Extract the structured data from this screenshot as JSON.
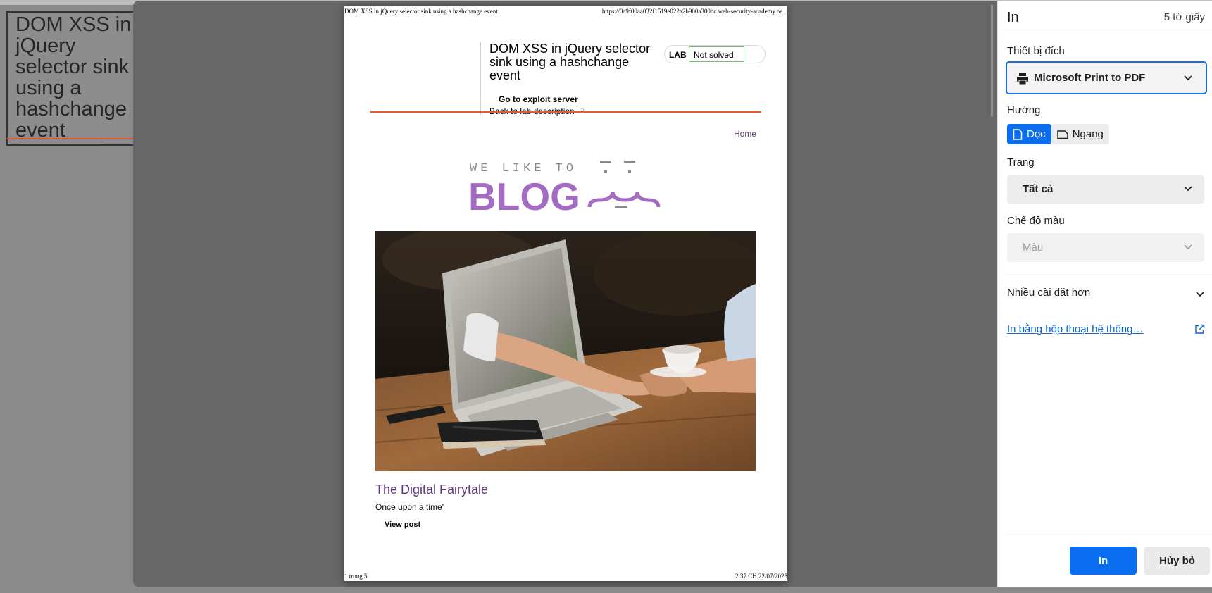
{
  "background_page": {
    "title": "DOM XSS in jQuery selector sink using a hashchange event"
  },
  "preview": {
    "header_left": "DOM XSS in jQuery selector sink using a hashchange event",
    "header_right": "https://0a9f00aa032f1519e022a2b900a300bc.web-security-academy.ne...",
    "footer_left": "1 trong 5",
    "footer_right": "2:37 CH 22/07/2025",
    "lab": {
      "title": "DOM XSS in jQuery selector sink using a hashchange event",
      "badge_label": "LAB",
      "status": "Not solved",
      "exploit_link": "Go to exploit server",
      "description_link": "Back to lab description"
    },
    "nav_home": "Home",
    "logo": {
      "top_text": "WE LIKE TO",
      "main_text": "BLOG",
      "color": "#a36cc2"
    },
    "post": {
      "title": "The Digital Fairytale",
      "excerpt": "Once upon a time'",
      "button": "View post"
    }
  },
  "panel": {
    "title": "In",
    "sheets": "5 tờ giấy",
    "destination_label": "Thiết bị đích",
    "destination_value": "Microsoft Print to PDF",
    "orientation_label": "Hướng",
    "orientation_portrait": "Dọc",
    "orientation_landscape": "Ngang",
    "pages_label": "Trang",
    "pages_value": "Tất cả",
    "color_mode_label": "Chế độ màu",
    "color_mode_value": "Màu",
    "more_settings": "Nhiều cài đặt hơn",
    "system_dialog_link": "In bằng hộp thoại hệ thống…",
    "print_button": "In",
    "cancel_button": "Hủy bỏ",
    "accent_color": "#0b6df0"
  }
}
